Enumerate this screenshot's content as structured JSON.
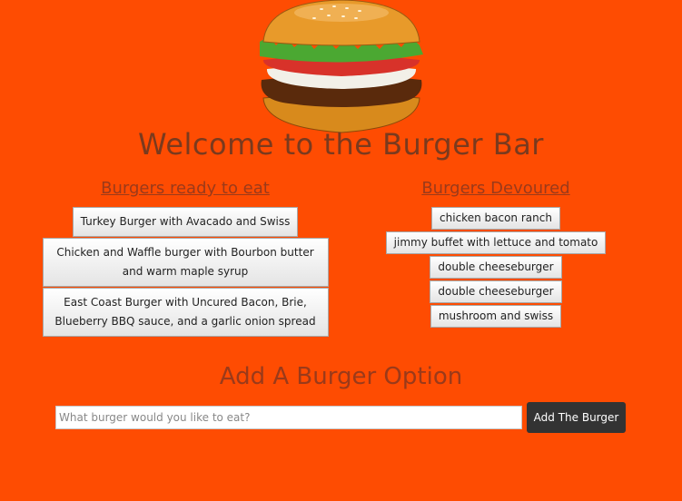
{
  "header": {
    "title": "Welcome to the Burger Bar",
    "logo_icon": "burger-icon"
  },
  "ready": {
    "heading": "Burgers ready to eat",
    "items": [
      "Turkey Burger with Avacado and Swiss",
      "Chicken and Waffle burger with Bourbon butter and warm maple syrup",
      "East Coast Burger with Uncured Bacon, Brie, Blueberry BBQ sauce, and a garlic onion spread"
    ]
  },
  "devoured": {
    "heading": "Burgers Devoured",
    "items": [
      "chicken bacon ranch",
      "jimmy buffet with lettuce and tomato",
      "double cheeseburger",
      "double cheeseburger",
      "mushroom and swiss"
    ]
  },
  "add": {
    "heading": "Add A Burger Option",
    "placeholder": "What burger would you like to eat?",
    "button_label": "Add The Burger"
  },
  "colors": {
    "background": "#fe4c02",
    "button": "#333333"
  }
}
